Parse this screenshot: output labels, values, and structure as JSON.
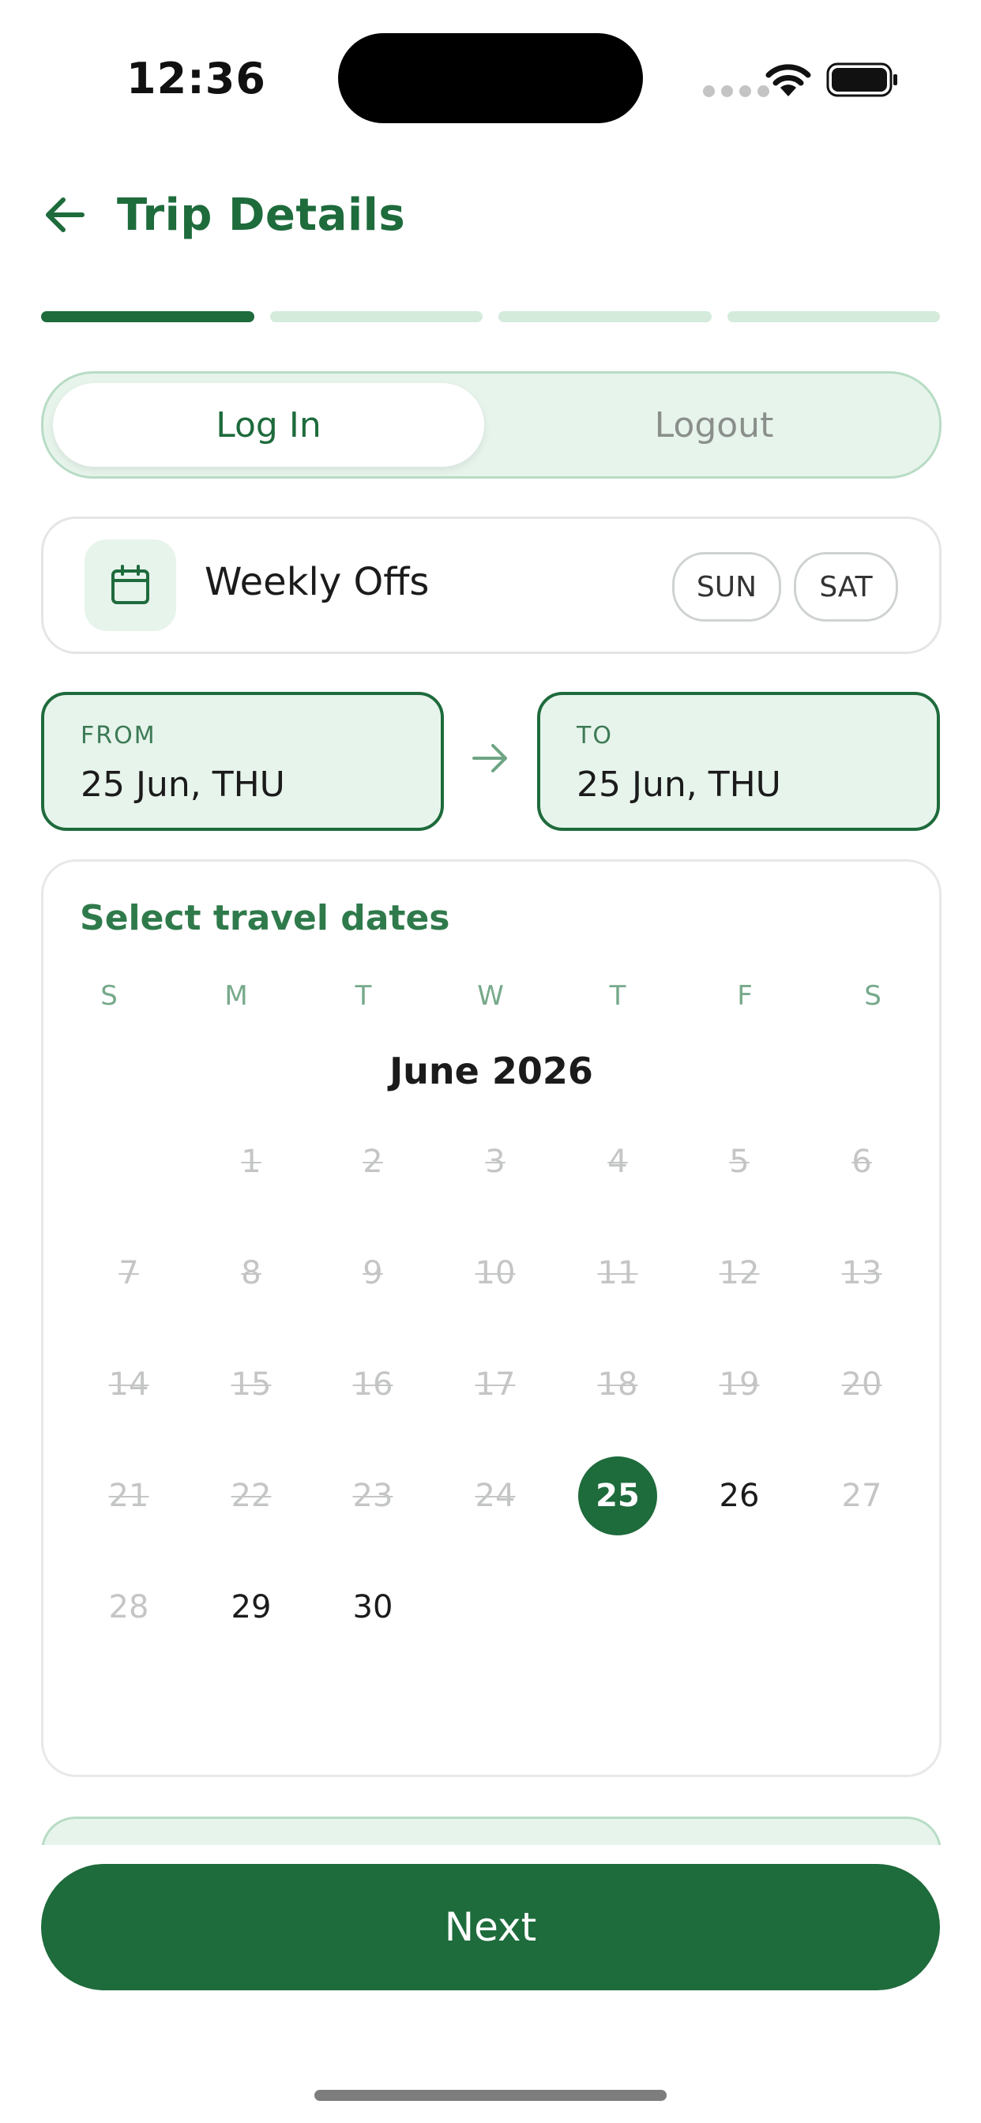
{
  "status_bar": {
    "time": "12:36"
  },
  "header": {
    "title": "Trip Details"
  },
  "progress": {
    "total_steps": 4,
    "current_step": 1
  },
  "toggle": {
    "left_label": "Log In",
    "right_label": "Logout",
    "selected": "left"
  },
  "weekly_offs": {
    "label": "Weekly Offs",
    "days": [
      "SUN",
      "SAT"
    ]
  },
  "date_range": {
    "from_label": "FROM",
    "from_value": "25 Jun, THU",
    "to_label": "TO",
    "to_value": "25 Jun, THU"
  },
  "calendar": {
    "heading": "Select travel dates",
    "weekdays": [
      "S",
      "M",
      "T",
      "W",
      "T",
      "F",
      "S"
    ],
    "month": "June 2026",
    "first_weekday_index": 1,
    "days_in_month": 30,
    "selected_day": 25,
    "available_days": [
      26,
      29,
      30
    ],
    "muted_days": [
      27,
      28
    ]
  },
  "footer": {
    "next_label": "Next"
  },
  "colors": {
    "primary": "#1e6b3c",
    "primary_light": "#e7f4ec",
    "progress_inactive": "#d4ebdc",
    "disabled_text": "#c4c6c5"
  }
}
